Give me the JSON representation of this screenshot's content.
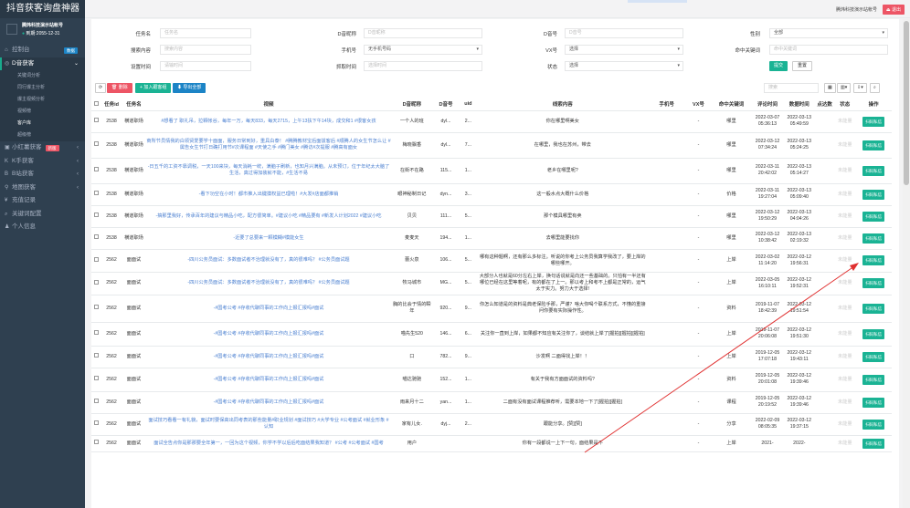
{
  "app": {
    "title": "抖音获客询盘神器"
  },
  "user": {
    "name": "腾炜科技演示站帐号",
    "expiry": "到期:2055-12-31"
  },
  "sidebar": {
    "items": [
      {
        "icon": "home-icon",
        "label": "控制台",
        "badge": "数据"
      },
      {
        "icon": "eye-icon",
        "label": "D音获客"
      },
      {
        "sub": true,
        "label": "关键词分析"
      },
      {
        "sub": true,
        "label": "同行爆主分析"
      },
      {
        "sub": true,
        "label": "爆主视频分析"
      },
      {
        "sub": true,
        "label": "视频榜"
      },
      {
        "sub": true,
        "label": "客户库",
        "active": true
      },
      {
        "sub": true,
        "label": "超级榜"
      },
      {
        "icon": "book-icon",
        "label": "小红薯获客",
        "badge": "新版"
      },
      {
        "icon": "k-icon",
        "label": "K手获客"
      },
      {
        "icon": "b-icon",
        "label": "B站获客"
      },
      {
        "icon": "map-icon",
        "label": "地图获客"
      },
      {
        "icon": "yen-icon",
        "label": "充值记录"
      },
      {
        "icon": "search-icon",
        "label": "关键词配置"
      },
      {
        "icon": "person-icon",
        "label": "个人信息"
      }
    ]
  },
  "topbar": {
    "demo": "腾炜科技演示站帐号",
    "logout": "退出"
  },
  "filters": {
    "task_name": {
      "label": "任务名",
      "placeholder": "任务名"
    },
    "d_nick": {
      "label": "D音昵称",
      "placeholder": "D音昵称"
    },
    "d_id": {
      "label": "D音号",
      "placeholder": "D音号"
    },
    "gender": {
      "label": "性别",
      "value": "全部"
    },
    "comment": {
      "label": "搜索内容",
      "placeholder": "搜索内容"
    },
    "phone": {
      "label": "手机号",
      "value": "无手机号码"
    },
    "vx": {
      "label": "VX号",
      "value": "选择"
    },
    "kw": {
      "label": "命中关键词",
      "placeholder": "命中关键词"
    },
    "settime": {
      "label": "设置时间",
      "placeholder": "请输时间"
    },
    "crawltime": {
      "label": "抓取时间",
      "placeholder": "选择时间"
    },
    "status": {
      "label": "状态",
      "value": "选择"
    },
    "submit": "提交",
    "reset": "重置"
  },
  "toolbar": {
    "delete": "删除",
    "add": "加入跟客组",
    "export": "导出全部",
    "search_placeholder": "搜索"
  },
  "columns": [
    "任务id",
    "任务名",
    "视频",
    "D音昵称",
    "D音号",
    "uid",
    "线索内容",
    "手机号",
    "VX号",
    "命中关键词",
    "评论时间",
    "数据时间",
    "点达数",
    "状态",
    "操作"
  ],
  "rows": [
    {
      "id": "2538",
      "task": "横道职场",
      "video": "#想看了 职礼吊，拉颗帐谷，每年一万，每天833，每天2715，上午13扶下午14块，成交和1 #很客女孩",
      "nick": "一个人的班",
      "did": "dyl...",
      "uid": "2...",
      "lead": "你在哪里啊美女",
      "phone": "",
      "vx": "-",
      "kw": "哪里",
      "ct": "2022-03-07 05:36:13",
      "dt": "2022-03-13 05:49:59",
      "n": "未能量",
      "op": "扫码私信"
    },
    {
      "id": "2538",
      "task": "横道职场",
      "video": "商所节员情我的白领贤爱要学十面面，服务日常到好，重具白泰！ #腾腾教材宝后面拔客后 #顺腾人的女生节怎么让 #属告女生节打日确打用节#次课程面 #天使之手 #腾门美女 #腾访#次提服 #腾高有面女",
      "nick": "梅晓飘香",
      "did": "dyl...",
      "uid": "7...",
      "lead": "在哪里，我也在苏州，带去",
      "phone": "",
      "vx": "-",
      "kw": "哪里",
      "ct": "2022-03-12 07:34:24",
      "dt": "2022-03-13 05:24:25",
      "n": "未能量",
      "op": "扫码私信"
    },
    {
      "id": "2538",
      "task": "横道职场",
      "video": "-日五千的工资不靠调税，一天100来块，每天消耗一统，满脑子刷新，也知月兴满脑。从未预订，位于年纪太大脑了生活，真过得加装就不能，#生活不易",
      "nick": "在街不在路",
      "did": "115...",
      "uid": "1...",
      "lead": "老乡在哪里呢?",
      "phone": "",
      "vx": "-",
      "kw": "哪里",
      "ct": "2022-03-11 20:42:02",
      "dt": "2022-03-13 05:14:27",
      "n": "未能量",
      "op": "扫码私信"
    },
    {
      "id": "2538",
      "task": "横道职场",
      "video": "-看下功空在小时！都市推入出键摸权益已理啦！#大发#店面都推销",
      "nick": "眼神秘制日记",
      "did": "dyn...",
      "uid": "3...",
      "lead": "这一般水点大概什么价格",
      "phone": "",
      "vx": "-",
      "kw": "价格",
      "ct": "2022-03-11 19:27:04",
      "dt": "2022-03-13 05:09:40",
      "n": "未能量",
      "op": "扫码私信"
    },
    {
      "id": "2538",
      "task": "横道职场",
      "video": "-搞那里我好，传承百年的建议与精品小吃，配方很简单。#建议小吃 #精品要有 #新发人计划2022 #建议小吃",
      "nick": "贝贝",
      "did": "111...",
      "uid": "5...",
      "lead": "那个模具哪里有卖",
      "phone": "",
      "vx": "-",
      "kw": "哪里",
      "ct": "2022-03-12 19:50:29",
      "dt": "2022-03-13 04:04:26",
      "n": "未能量",
      "op": "扫码私信"
    },
    {
      "id": "2538",
      "task": "横道职场",
      "video": "-近要了总要来一颗模糊#模能女生",
      "nick": "麦麦天",
      "did": "194...",
      "uid": "1...",
      "lead": "去哪里能要找你",
      "phone": "",
      "vx": "-",
      "kw": "哪里",
      "ct": "2022-03-12 10:38:42",
      "dt": "2022-03-13 02:19:32",
      "n": "未能量",
      "op": "扫码私信"
    },
    {
      "id": "2562",
      "task": "面面试",
      "video": "-四川公务员面试：多数面试者不治理就没有了，真的很难吗？ #公务员面试题",
      "nick": "蕾火泉",
      "did": "106...",
      "uid": "5...",
      "lead": "哪有这种题啊，还有那么多标注。听说的你考上公务员我算学我改了，要上岸的哪些哪开。",
      "phone": "",
      "vx": "-",
      "kw": "上岸",
      "ct": "2022-03-02 11:14:20",
      "dt": "2022-03-12 19:56:31",
      "n": "未能量",
      "op": "扫码私信"
    },
    {
      "id": "2562",
      "task": "面面试",
      "video": "-四川公务员面试：多数面试者不治理就没有了，真的很难吗？ #公务员面试题",
      "nick": "牧马城市",
      "did": "MG...",
      "uid": "5...",
      "lead": "大部分人也就是60分左右上岸，换句话说就是向还一些基础的。只怕有一半还有哪位已经在这里等着呢，有的都在了上一。那以考上和考不上都是正常的，运气太于实力。努力大于选择!",
      "phone": "",
      "vx": "-",
      "kw": "上岸",
      "ct": "2022-03-05 16:10:11",
      "dt": "2022-03-12 19:52:31",
      "n": "未能量",
      "op": "扫码私信"
    },
    {
      "id": "2562",
      "task": "面面试",
      "video": "-#国考公考 #存收代聊同事的工作向上报汇报吗#面试",
      "nick": "胸的比会于情的瞬年",
      "did": "920...",
      "uid": "9...",
      "lead": "你怎么知道是的资料是典老保险手那，严谨？啥大你喝个联系方式，不懂的重接问你要有实际操作性。",
      "phone": "",
      "vx": "-",
      "kw": "资料",
      "ct": "2019-11-07 18:42:39",
      "dt": "2022-03-12 19:51:54",
      "n": "未能量",
      "op": "扫码私信"
    },
    {
      "id": "2562",
      "task": "面面试",
      "video": "-#国考公考 #存收代聊同事的工作向上报汇报吗#面试",
      "nick": "喵先生520",
      "did": "146...",
      "uid": "6...",
      "lead": "关注你一直到上岸，如果都不知应有关注你了，谈结就上岸了[握拍][握拍][握拍]",
      "phone": "",
      "vx": "-",
      "kw": "上岸",
      "ct": "2019-11-07 20:06:08",
      "dt": "2022-03-12 19:51:30",
      "n": "未能量",
      "op": "扫码私信"
    },
    {
      "id": "2562",
      "task": "面面试",
      "video": "-#国考公考 #存收代聊同事的工作向上报汇报吗#面试",
      "nick": "口",
      "did": "782...",
      "uid": "9...",
      "lead": "沙发啊 二面得找上岸！！",
      "phone": "",
      "vx": "-",
      "kw": "上岸",
      "ct": "2019-12-05 17:07:18",
      "dt": "2022-03-12 19:43:11",
      "n": "未能量",
      "op": "扫码私信"
    },
    {
      "id": "2562",
      "task": "面面试",
      "video": "-#国考公考 #存收代聊同事的工作向上报汇报吗#面试",
      "nick": "喵达驰驰",
      "did": "152...",
      "uid": "1...",
      "lead": "有关于我有方面面试的资料吗?",
      "phone": "",
      "vx": "-",
      "kw": "资料",
      "ct": "2019-12-05 20:01:08",
      "dt": "2022-03-12 19:39:46",
      "n": "未能量",
      "op": "扫码私信"
    },
    {
      "id": "2562",
      "task": "面面试",
      "video": "-#国考公考 #存收代聊同事的工作向上报汇报吗#面试",
      "nick": "雨来月十二",
      "did": "yan...",
      "uid": "1...",
      "lead": "二面有没有面试课程推荐听，需要本地一下了[握拍][握拍]",
      "phone": "",
      "vx": "-",
      "kw": "课程",
      "ct": "2019-12-05 20:19:52",
      "dt": "2022-03-12 19:39:46",
      "n": "未能量",
      "op": "扫码私信"
    },
    {
      "id": "2562",
      "task": "面面试",
      "video": "面试技巧看看一有礼貌，面试时要保高出同考表的那些能量#职业规划 #面试技巧 #大学专业 #公考面试 #就业形象 #认知",
      "nick": "家有儿女.",
      "did": "dyj...",
      "uid": "2...",
      "lead": "跟能分享。[赞][赞]",
      "phone": "",
      "vx": "-",
      "kw": "分享",
      "ct": "2022-02-09 08:05:35",
      "dt": "2022-03-12 19:37:15",
      "n": "未能量",
      "op": "扫码私信"
    },
    {
      "id": "2562",
      "task": "面面试",
      "video": "面试全告点你是那那要全年第一，一回为这个视频，你学不学以后后吃面结果我知道？ #公考 #公考面试 #国考",
      "nick": "用户",
      "did": "",
      "uid": "",
      "lead": "你有一段都说一上下一句，面结果是不",
      "phone": "",
      "vx": "-",
      "kw": "上岸",
      "ct": "2021-",
      "dt": "2022-",
      "n": "未能量",
      "op": "扫码私信"
    }
  ]
}
